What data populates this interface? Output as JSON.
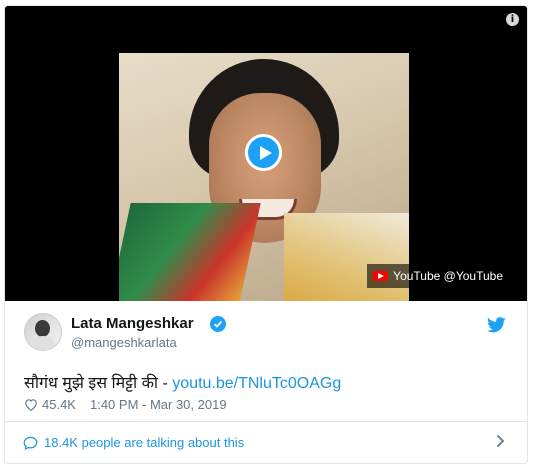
{
  "media": {
    "youtube_badge": "YouTube @YouTube",
    "info_icon": "info-icon",
    "play_icon": "play-icon"
  },
  "author": {
    "name": "Lata Mangeshkar",
    "handle": "@mangeshkarlata",
    "verified": true
  },
  "tweet": {
    "text": "सौगंध मुझे इस मिट्टी की - ",
    "link": "youtu.be/TNluTc0OAGg"
  },
  "meta": {
    "likes": "45.4K",
    "timestamp": "1:40 PM - Mar 30, 2019"
  },
  "footer": {
    "label": "18.4K people are talking about this"
  },
  "colors": {
    "accent": "#1da1f2",
    "link": "#1b95e0",
    "muted": "#657786",
    "border": "#e1e8ed"
  }
}
